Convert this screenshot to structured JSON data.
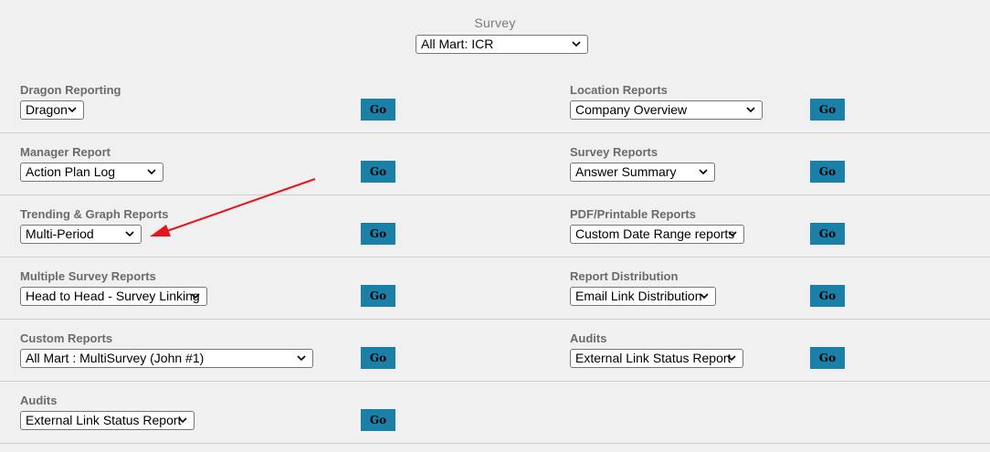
{
  "survey": {
    "label": "Survey",
    "selected": "All Mart: ICR"
  },
  "go_label": "Go",
  "left_sections": [
    {
      "title": "Dragon Reporting",
      "selected": "Dragon"
    },
    {
      "title": "Manager Report",
      "selected": "Action Plan Log"
    },
    {
      "title": "Trending & Graph Reports",
      "selected": "Multi-Period"
    },
    {
      "title": "Multiple Survey Reports",
      "selected": "Head to Head - Survey Linking"
    },
    {
      "title": "Custom Reports",
      "selected": "All Mart : MultiSurvey (John #1)"
    },
    {
      "title": "Audits",
      "selected": "External Link Status Report"
    }
  ],
  "right_sections": [
    {
      "title": "Location Reports",
      "selected": "Company Overview"
    },
    {
      "title": "Survey Reports",
      "selected": "Answer Summary"
    },
    {
      "title": "PDF/Printable Reports",
      "selected": "Custom Date Range reports"
    },
    {
      "title": "Report Distribution",
      "selected": "Email Link Distribution"
    },
    {
      "title": "Audits",
      "selected": "External Link Status Report"
    }
  ],
  "colors": {
    "go_button": "#1a80a8",
    "annotation_arrow": "#e8141b",
    "section_title": "#6b6b6b"
  }
}
